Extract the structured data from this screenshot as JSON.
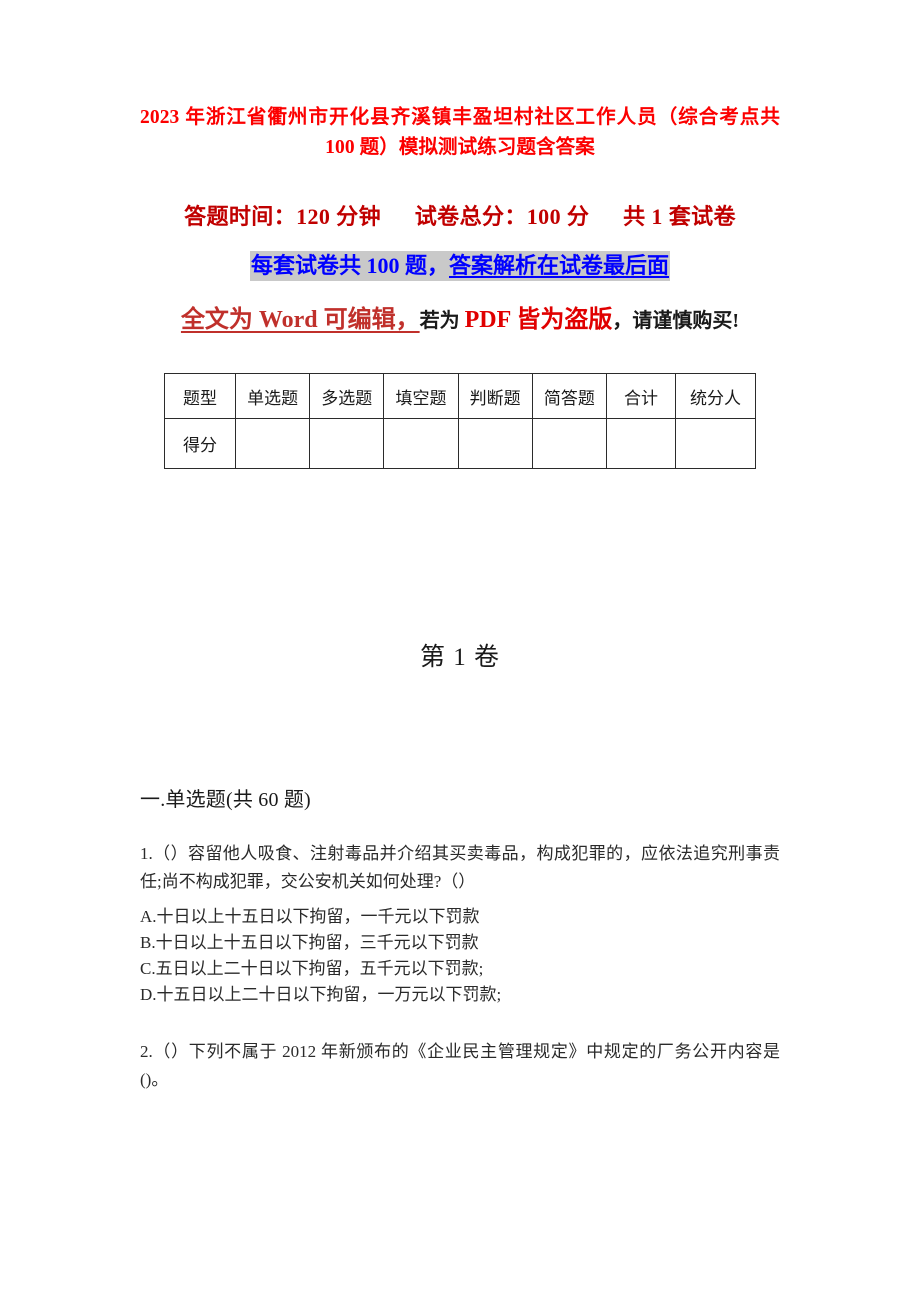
{
  "document": {
    "title": "2023 年浙江省衢州市开化县齐溪镇丰盈坦村社区工作人员（综合考点共 100 题）模拟测试练习题含答案",
    "volume_heading": "第 1 卷"
  },
  "exam_meta": {
    "duration_label": "答题时间：120 分钟",
    "total_score_label": "试卷总分：100 分",
    "paper_count_label": "共 1 套试卷",
    "per_paper_prefix": "每套试卷共 100 题，",
    "per_paper_underlined": "答案解析在试卷最后面",
    "notice_red_underlined": "全文为 Word 可编辑，",
    "notice_dark_1": "若为 ",
    "notice_red_2": "PDF 皆为盗版",
    "notice_dark_2": "，请谨慎购买!"
  },
  "score_table": {
    "headers": [
      "题型",
      "单选题",
      "多选题",
      "填空题",
      "判断题",
      "简答题",
      "合计",
      "统分人"
    ],
    "row_label": "得分",
    "row_values": [
      "",
      "",
      "",
      "",
      "",
      "",
      ""
    ]
  },
  "sections": {
    "single_choice_heading": "一.单选题(共 60 题)"
  },
  "questions": [
    {
      "stem": "1.（）容留他人吸食、注射毒品并介绍其买卖毒品，构成犯罪的，应依法追究刑事责任;尚不构成犯罪，交公安机关如何处理?（）",
      "options": [
        "A.十日以上十五日以下拘留，一千元以下罚款",
        "B.十日以上十五日以下拘留，三千元以下罚款",
        "C.五日以上二十日以下拘留，五千元以下罚款;",
        "D.十五日以上二十日以下拘留，一万元以下罚款;"
      ]
    },
    {
      "stem": "2.（）下列不属于 2012 年新颁布的《企业民主管理规定》中规定的厂务公开内容是()。",
      "options": []
    }
  ],
  "colors": {
    "title_red": "#fc0000",
    "meta_red": "#c00000",
    "highlight_blue": "#0000ff",
    "highlight_bg": "#c9c9c9",
    "notice_red": "#e00000",
    "body_text": "#2a2a2a"
  }
}
